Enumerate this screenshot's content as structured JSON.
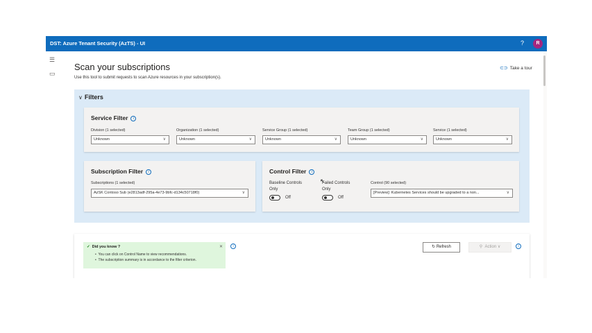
{
  "app": {
    "title": "DST: Azure Tenant Security (AzTS) - UI",
    "help_icon": "?",
    "avatar_initial": "R"
  },
  "nav": {
    "menu_icon": "hamburger-icon",
    "scan_icon": "document-icon"
  },
  "page": {
    "title": "Scan your subscriptions",
    "subtitle": "Use this tool to submit requests to scan Azure resources in your subscription(s).",
    "tour_label": "Take a tour"
  },
  "filters": {
    "header": "Filters",
    "service_filter": {
      "title": "Service Filter",
      "dropdowns": [
        {
          "label": "Division (1 selected)",
          "value": "Unknown"
        },
        {
          "label": "Organization (1 selected)",
          "value": "Unknown"
        },
        {
          "label": "Service Group (1 selected)",
          "value": "Unknown"
        },
        {
          "label": "Team Group (1 selected)",
          "value": "Unknown"
        },
        {
          "label": "Service (1 selected)",
          "value": "Unknown"
        }
      ]
    },
    "subscription_filter": {
      "title": "Subscription Filter",
      "label": "Subscriptions (1 selected)",
      "value": "AzSK Contoso Sub (e2813adf-295a-4e73-9bfc-d134c50718f0)"
    },
    "control_filter": {
      "title": "Control Filter",
      "baseline_label_1": "Baseline Controls",
      "baseline_label_2": "Only",
      "baseline_state": "Off",
      "failed_label_1": "Failed Controls",
      "failed_label_2": "Only",
      "failed_state": "Off",
      "control_label": "Control (90 selected)",
      "control_value": "[Preview]: Kubernetes Services should be upgraded to a non..."
    }
  },
  "tips": {
    "title": "Did you know ?",
    "lines": [
      "You can click on Control Name to view recommendations.",
      "The subscription summary is in accordance to the filter criterion."
    ]
  },
  "toolbar": {
    "refresh_label": "Refresh",
    "action_label": "Action"
  }
}
